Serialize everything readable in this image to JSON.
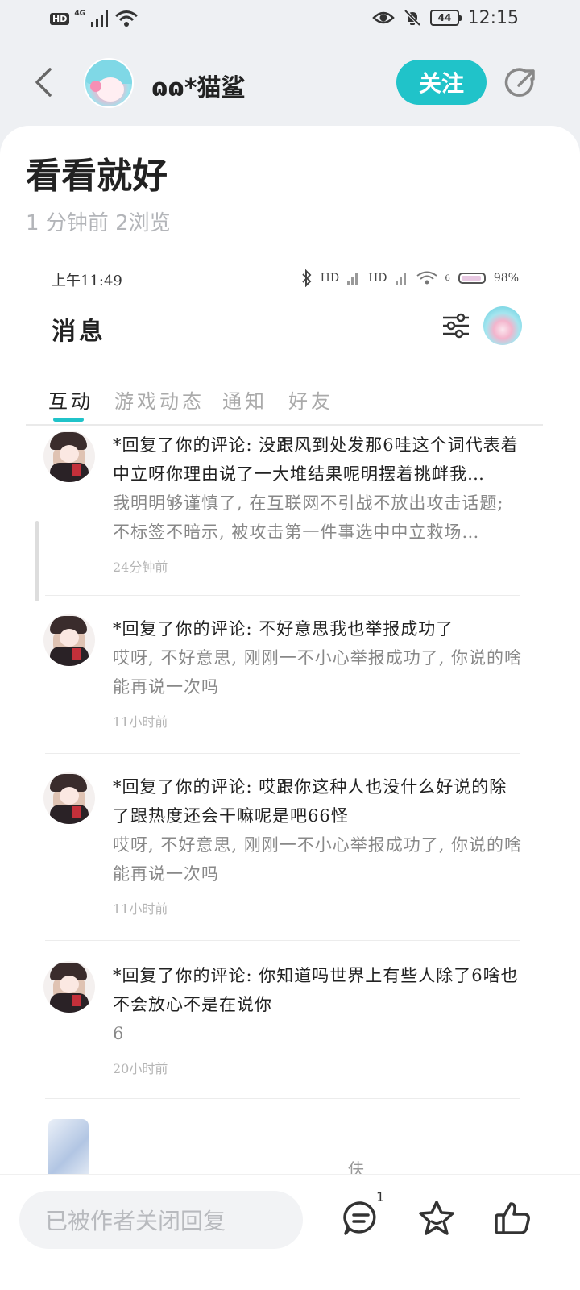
{
  "status_bar": {
    "left_badge": "HD",
    "network": "4G",
    "battery": "44",
    "time": "12:15"
  },
  "header": {
    "author_name": "ɷɷ*猫鲨",
    "follow_label": "关注"
  },
  "post": {
    "title": "看看就好",
    "meta": "1 分钟前  2浏览"
  },
  "screenshot": {
    "status": {
      "time": "上午11:49",
      "battery": "98%",
      "hd1": "HD",
      "hd2": "HD",
      "wifi_num": "6"
    },
    "title": "消息",
    "tabs": [
      "互动",
      "游戏动态",
      "通知",
      "好友"
    ],
    "messages": [
      {
        "main": "*回复了你的评论: 没跟风到处发那6哇这个词代表着中立呀你理由说了一大堆结果呢明摆着挑衅我…",
        "sub": "我明明够谨慎了, 在互联网不引战不放出攻击话题; 不标签不暗示, 被攻击第一件事选中中立救场…",
        "time": "24分钟前"
      },
      {
        "main": "*回复了你的评论: 不好意思我也举报成功了",
        "sub": "哎呀, 不好意思, 刚刚一不小心举报成功了, 你说的啥能再说一次吗",
        "time": "11小时前"
      },
      {
        "main": "*回复了你的评论: 哎跟你这种人也没什么好说的除了跟热度还会干嘛呢是吧66怪",
        "sub": "哎呀, 不好意思, 刚刚一不小心举报成功了, 你说的啥能再说一次吗",
        "time": "11小时前"
      },
      {
        "main": "*回复了你的评论: 你知道吗世界上有些人除了6啥也不会放心不是在说你",
        "sub": "6",
        "time": "20小时前"
      }
    ],
    "partial_text": "伕"
  },
  "bottom_bar": {
    "reply_placeholder": "已被作者关闭回复",
    "comment_count": "1"
  },
  "colors": {
    "accent": "#20c3c9",
    "page_bg": "#eef0f3"
  },
  "icons": [
    "back-arrow-icon",
    "share-icon",
    "filter-icon",
    "comment-icon",
    "star-icon",
    "thumbs-up-icon",
    "eye-icon",
    "bell-off-icon",
    "wifi-icon",
    "signal-icon",
    "bluetooth-icon"
  ]
}
